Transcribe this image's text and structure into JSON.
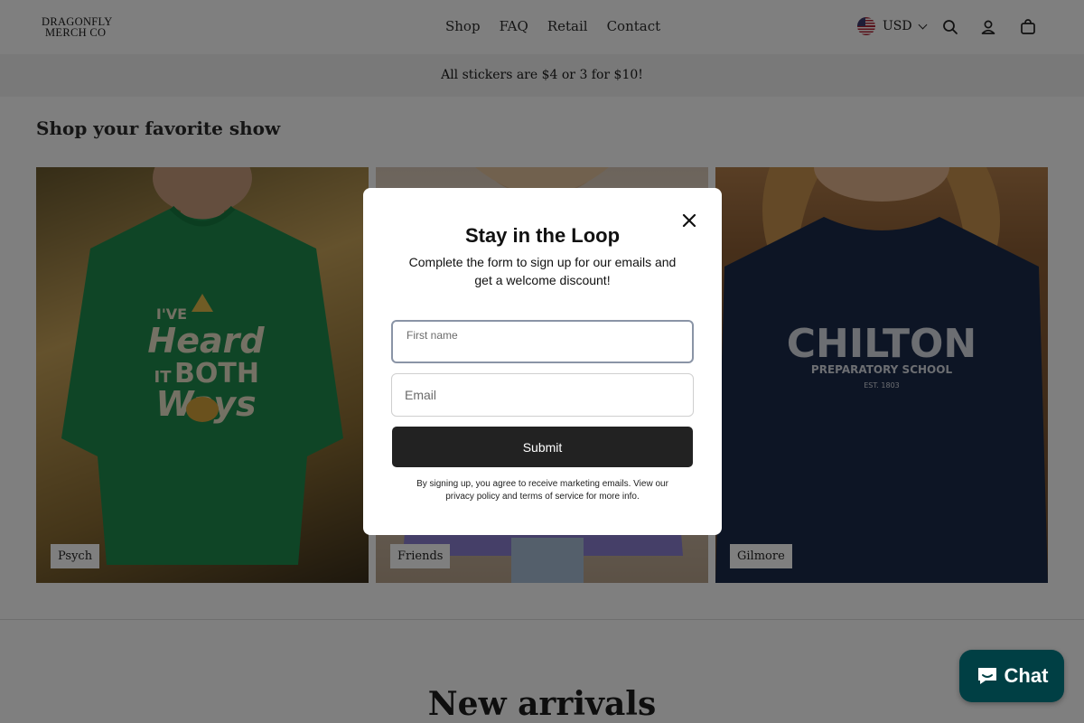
{
  "header": {
    "logo_line1": "DRAGONFLY",
    "logo_line2": "MERCH CO",
    "nav": [
      "Shop",
      "FAQ",
      "Retail",
      "Contact"
    ],
    "currency": "USD"
  },
  "announcement": "All stickers are $4 or 3 for $10!",
  "section": {
    "title": "Shop your favorite show",
    "cards": [
      {
        "label": "Psych"
      },
      {
        "label": "Friends"
      },
      {
        "label": "Gilmore"
      }
    ],
    "shirt_graphics": {
      "psych": [
        "I'VE",
        "Heard",
        "IT",
        "BOTH",
        "Ways"
      ],
      "gilmore": [
        "CHILTON",
        "PREPARATORY SCHOOL",
        "EST. 1803"
      ]
    }
  },
  "next_section_title": "New arrivals",
  "modal": {
    "title": "Stay in the Loop",
    "subtitle": "Complete the form to sign up for our emails and get a welcome discount!",
    "first_name_label": "First name",
    "email_placeholder": "Email",
    "submit_label": "Submit",
    "legal": "By signing up, you agree to receive marketing emails. View our privacy policy and terms of service for more info."
  },
  "chat": {
    "label": "Chat"
  },
  "colors": {
    "overlay": "#000000",
    "button_dark": "#222222",
    "chat_bg": "#003f44",
    "announcement_bg": "#f2f2f2"
  }
}
